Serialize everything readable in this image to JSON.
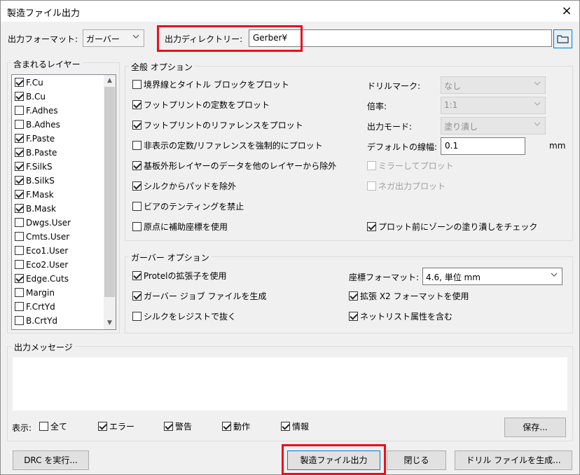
{
  "window": {
    "title": "製造ファイル出力",
    "close_icon": "×"
  },
  "top": {
    "format_label": "出力フォーマット:",
    "format_value": "ガーバー",
    "dir_label": "出力ディレクトリー:",
    "dir_value": "Gerber¥"
  },
  "layers": {
    "title": "含まれるレイヤー",
    "items": [
      {
        "label": "F.Cu",
        "checked": true
      },
      {
        "label": "B.Cu",
        "checked": true
      },
      {
        "label": "F.Adhes",
        "checked": false
      },
      {
        "label": "B.Adhes",
        "checked": false
      },
      {
        "label": "F.Paste",
        "checked": true
      },
      {
        "label": "B.Paste",
        "checked": true
      },
      {
        "label": "F.SilkS",
        "checked": true
      },
      {
        "label": "B.SilkS",
        "checked": true
      },
      {
        "label": "F.Mask",
        "checked": true
      },
      {
        "label": "B.Mask",
        "checked": true
      },
      {
        "label": "Dwgs.User",
        "checked": false
      },
      {
        "label": "Cmts.User",
        "checked": false
      },
      {
        "label": "Eco1.User",
        "checked": false
      },
      {
        "label": "Eco2.User",
        "checked": false
      },
      {
        "label": "Edge.Cuts",
        "checked": true
      },
      {
        "label": "Margin",
        "checked": false
      },
      {
        "label": "F.CrtYd",
        "checked": false
      },
      {
        "label": "B.CrtYd",
        "checked": false
      }
    ]
  },
  "general": {
    "title": "全般 オプション",
    "checks": [
      {
        "label": "境界線とタイトル ブロックをプロット",
        "checked": false
      },
      {
        "label": "フットプリントの定数をプロット",
        "checked": true
      },
      {
        "label": "フットプリントのリファレンスをプロット",
        "checked": true
      },
      {
        "label": "非表示の定数/リファレンスを強制的にプロット",
        "checked": false
      },
      {
        "label": "基板外形レイヤーのデータを他のレイヤーから除外",
        "checked": true
      },
      {
        "label": "シルクからパッドを除外",
        "checked": true
      },
      {
        "label": "ビアのテンティングを禁止",
        "checked": false
      },
      {
        "label": "原点に補助座標を使用",
        "checked": false
      }
    ],
    "drill_marks_label": "ドリルマーク:",
    "drill_marks_value": "なし",
    "scale_label": "倍率:",
    "scale_value": "1:1",
    "output_mode_label": "出力モード:",
    "output_mode_value": "塗り潰し",
    "line_width_label": "デフォルトの線幅:",
    "line_width_value": "0.1",
    "line_width_unit": "mm",
    "mirror_label": "ミラーしてプロット",
    "negative_label": "ネガ出力プロット",
    "zone_check_label": "プロット前にゾーンの塗り潰しをチェック"
  },
  "gerber": {
    "title": "ガーバー オプション",
    "checks": [
      {
        "label": "Protelの拡張子を使用",
        "checked": true
      },
      {
        "label": "ガーバー ジョブ ファイルを生成",
        "checked": true
      },
      {
        "label": "シルクをレジストで抜く",
        "checked": false
      }
    ],
    "coord_label": "座標フォーマット:",
    "coord_value": "4.6, 単位 mm",
    "x2_label": "拡張 X2 フォーマットを使用",
    "netlist_label": "ネットリスト属性を含む"
  },
  "messages": {
    "title": "出力メッセージ",
    "show_label": "表示:",
    "filters": [
      {
        "label": "全て",
        "checked": false
      },
      {
        "label": "エラー",
        "checked": true
      },
      {
        "label": "警告",
        "checked": true
      },
      {
        "label": "動作",
        "checked": true
      },
      {
        "label": "情報",
        "checked": true
      }
    ],
    "save_label": "保存..."
  },
  "bottom": {
    "drc_label": "DRC を実行...",
    "plot_label": "製造ファイル出力",
    "close_label": "閉じる",
    "drill_label": "ドリル ファイルを生成..."
  },
  "colors": {
    "highlight": "#e8101d",
    "accent": "#0078d7"
  }
}
